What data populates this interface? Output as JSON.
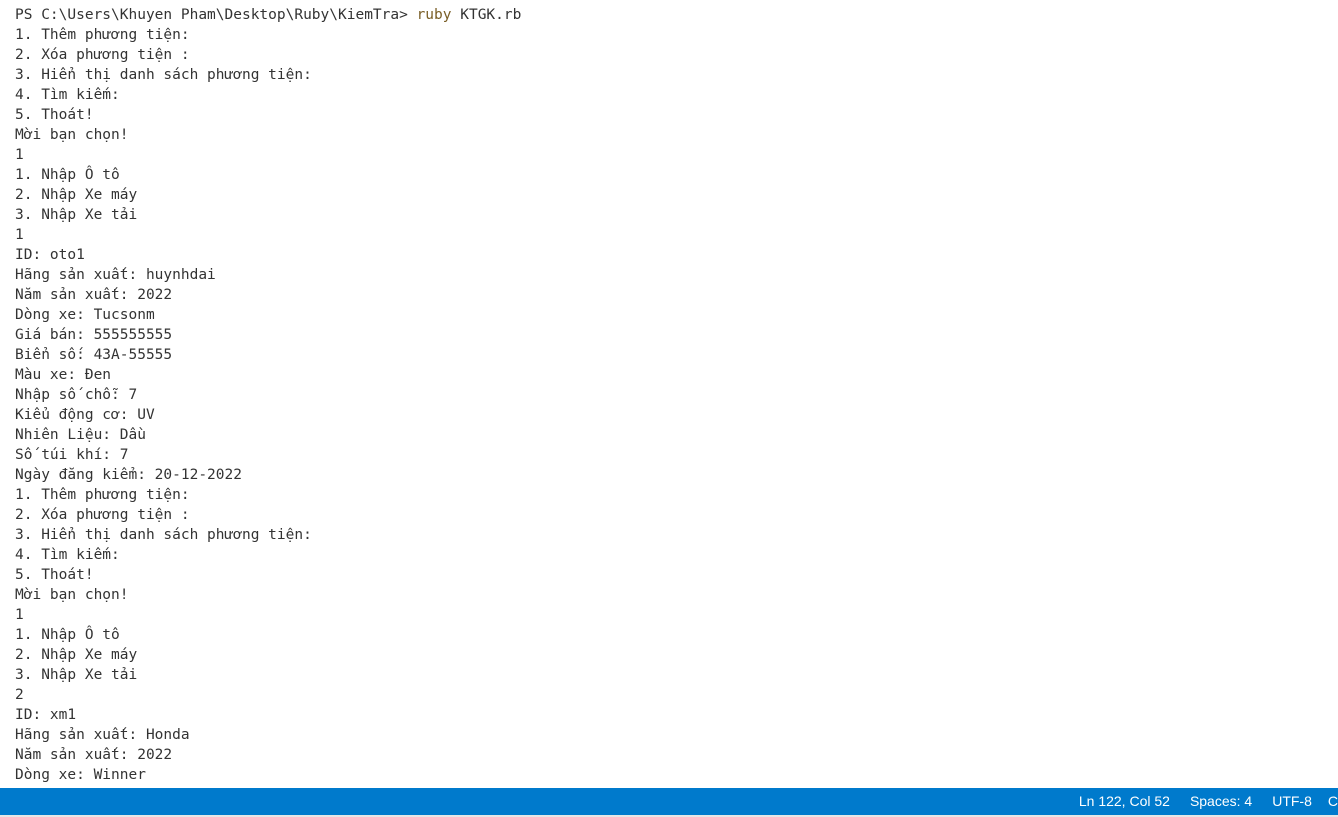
{
  "terminal": {
    "clipped_top_line": "     ...     ...     ",
    "prompt": {
      "path": "PS C:\\Users\\Khuyen Pham\\Desktop\\Ruby\\KiemTra>",
      "command": "ruby",
      "args": "KTGK.rb"
    },
    "lines": [
      "1. Thêm phương tiện:",
      "2. Xóa phương tiện :",
      "3. Hiển thị danh sách phương tiện:",
      "4. Tìm kiếm:",
      "5. Thoát!",
      "Mời bạn chọn!",
      "1",
      "1. Nhập Ô tô",
      "2. Nhập Xe máy",
      "3. Nhập Xe tải",
      "1",
      "ID: oto1",
      "Hãng sản xuất: huynhdai",
      "Năm sản xuất: 2022",
      "Dòng xe: Tucsonm",
      "Giá bán: 555555555",
      "Biển số: 43A-55555",
      "Màu xe: Đen",
      "Nhập số chỗ: 7",
      "Kiểu động cơ: UV",
      "Nhiên Liệu: Dầu",
      "Số túi khí: 7",
      "Ngày đăng kiểm: 20-12-2022",
      "1. Thêm phương tiện:",
      "2. Xóa phương tiện :",
      "3. Hiển thị danh sách phương tiện:",
      "4. Tìm kiếm:",
      "5. Thoát!",
      "Mời bạn chọn!",
      "1",
      "1. Nhập Ô tô",
      "2. Nhập Xe máy",
      "3. Nhập Xe tải",
      "2",
      "ID: xm1",
      "Hãng sản xuất: Honda",
      "Năm sản xuất: 2022",
      "Dòng xe: Winner"
    ]
  },
  "statusbar": {
    "position": "Ln 122, Col 52",
    "indentation": "Spaces: 4",
    "encoding": "UTF-8",
    "clipped": "C"
  },
  "colors": {
    "statusbar_bg": "#007acc",
    "command_color": "#795e26",
    "terminal_text": "#333333"
  }
}
